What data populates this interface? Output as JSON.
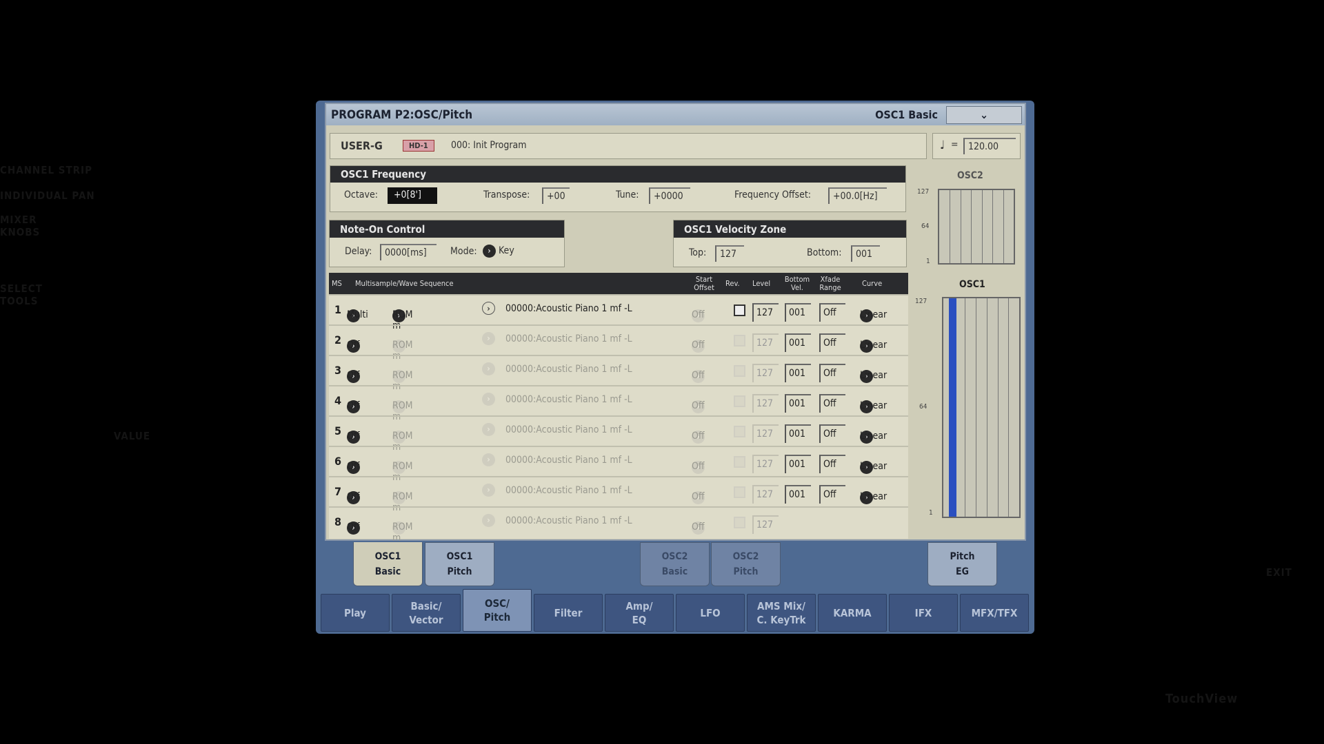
{
  "background_labels": {
    "channel_strip": "CHANNEL STRIP",
    "individual_pan": "INDIVIDUAL PAN",
    "mixer_knobs": "MIXER KNOBS",
    "select_tools": "SELECT TOOLS",
    "value": "VALUE",
    "exit": "EXIT",
    "brand": "TouchView"
  },
  "title": "PROGRAM P2:OSC/Pitch",
  "page_name": "OSC1 Basic",
  "program": {
    "bank": "USER-G",
    "type_badge": "HD-1",
    "name": "000: Init Program",
    "tempo_symbol": "♩",
    "tempo_eq": "=",
    "tempo": "120.00"
  },
  "frequency": {
    "header": "OSC1 Frequency",
    "octave_label": "Octave:",
    "octave": "+0[8']",
    "transpose_label": "Transpose:",
    "transpose": "+00",
    "tune_label": "Tune:",
    "tune": "+0000",
    "offset_label": "Frequency Offset:",
    "offset": "+00.0[Hz]"
  },
  "note_on": {
    "header": "Note-On Control",
    "delay_label": "Delay:",
    "delay": "0000[ms]",
    "mode_label": "Mode:",
    "mode": "Key"
  },
  "velocity_zone": {
    "header": "OSC1 Velocity Zone",
    "top_label": "Top:",
    "top": "127",
    "bottom_label": "Bottom:",
    "bottom": "001"
  },
  "table": {
    "headers": {
      "ms": "MS",
      "wave": "Multisample/Wave Sequence",
      "start": "Start Offset",
      "rev": "Rev.",
      "level": "Level",
      "bottom": "Bottom Vel.",
      "xfade": "Xfade Range",
      "curve": "Curve"
    },
    "rows": [
      {
        "n": "1",
        "mode": "Multi",
        "src": "ROM m",
        "wave": "00000:Acoustic Piano 1 mf -L",
        "start": "Off",
        "level": "127",
        "bottom": "001",
        "xfade": "Off",
        "curve": "Linear",
        "active": true
      },
      {
        "n": "2",
        "mode": "Off",
        "src": "ROM m",
        "wave": "00000:Acoustic Piano 1 mf -L",
        "start": "Off",
        "level": "127",
        "bottom": "001",
        "xfade": "Off",
        "curve": "Linear",
        "active": false
      },
      {
        "n": "3",
        "mode": "Off",
        "src": "ROM m",
        "wave": "00000:Acoustic Piano 1 mf -L",
        "start": "Off",
        "level": "127",
        "bottom": "001",
        "xfade": "Off",
        "curve": "Linear",
        "active": false
      },
      {
        "n": "4",
        "mode": "Off",
        "src": "ROM m",
        "wave": "00000:Acoustic Piano 1 mf -L",
        "start": "Off",
        "level": "127",
        "bottom": "001",
        "xfade": "Off",
        "curve": "Linear",
        "active": false
      },
      {
        "n": "5",
        "mode": "Off",
        "src": "ROM m",
        "wave": "00000:Acoustic Piano 1 mf -L",
        "start": "Off",
        "level": "127",
        "bottom": "001",
        "xfade": "Off",
        "curve": "Linear",
        "active": false
      },
      {
        "n": "6",
        "mode": "Off",
        "src": "ROM m",
        "wave": "00000:Acoustic Piano 1 mf -L",
        "start": "Off",
        "level": "127",
        "bottom": "001",
        "xfade": "Off",
        "curve": "Linear",
        "active": false
      },
      {
        "n": "7",
        "mode": "Off",
        "src": "ROM m",
        "wave": "00000:Acoustic Piano 1 mf -L",
        "start": "Off",
        "level": "127",
        "bottom": "001",
        "xfade": "Off",
        "curve": "Linear",
        "active": false
      },
      {
        "n": "8",
        "mode": "Off",
        "src": "ROM m",
        "wave": "00000:Acoustic Piano 1 mf -L",
        "start": "Off",
        "level": "127",
        "active": false
      }
    ]
  },
  "graphs": {
    "osc2_label": "OSC2",
    "osc1_label": "OSC1",
    "ticks": [
      "127",
      "64",
      "1"
    ],
    "osc1_zone": [
      1,
      127
    ],
    "accent": "#2a4fc0"
  },
  "subtabs": [
    {
      "label1": "OSC1",
      "label2": "Basic",
      "state": "active"
    },
    {
      "label1": "OSC1",
      "label2": "Pitch",
      "state": "normal"
    },
    {
      "label1": "OSC2",
      "label2": "Basic",
      "state": "disabled"
    },
    {
      "label1": "OSC2",
      "label2": "Pitch",
      "state": "disabled"
    },
    {
      "label1": "Pitch",
      "label2": "EG",
      "state": "normal"
    }
  ],
  "maintabs": [
    {
      "label1": "Play",
      "label2": ""
    },
    {
      "label1": "Basic/",
      "label2": "Vector"
    },
    {
      "label1": "OSC/",
      "label2": "Pitch",
      "active": true
    },
    {
      "label1": "Filter",
      "label2": ""
    },
    {
      "label1": "Amp/",
      "label2": "EQ"
    },
    {
      "label1": "LFO",
      "label2": ""
    },
    {
      "label1": "AMS Mix/",
      "label2": "C. KeyTrk"
    },
    {
      "label1": "KARMA",
      "label2": ""
    },
    {
      "label1": "IFX",
      "label2": ""
    },
    {
      "label1": "MFX/TFX",
      "label2": ""
    }
  ]
}
